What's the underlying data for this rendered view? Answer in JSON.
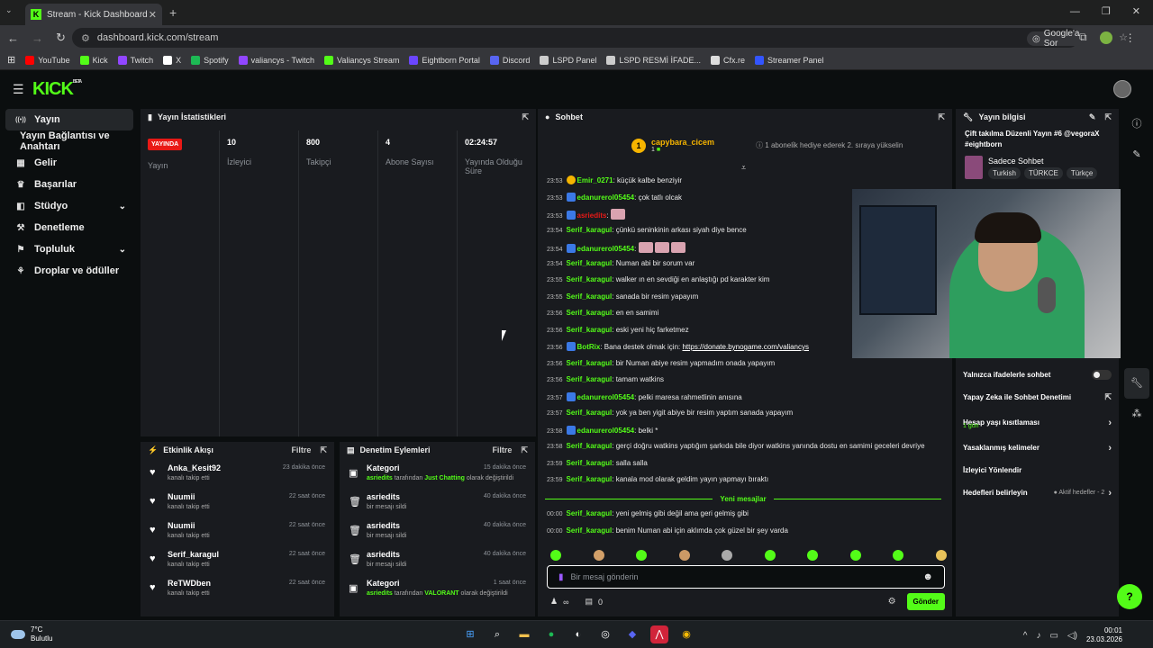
{
  "browser": {
    "tab_title": "Stream - Kick Dashboard",
    "url": "dashboard.kick.com/stream",
    "google_ask": "Google'a Sor",
    "bookmarks": [
      "YouTube",
      "Kick",
      "Twitch",
      "X",
      "Spotify",
      "valiancys - Twitch",
      "Valiancys Stream",
      "Eightborn Portal",
      "Discord",
      "LSPD Panel",
      "LSPD RESMİ İFADE...",
      "Cfx.re",
      "Streamer Panel"
    ],
    "bookmark_colors": [
      "#ff0000",
      "#53fc18",
      "#9146ff",
      "#ffffff",
      "#1db954",
      "#9146ff",
      "#53fc18",
      "#6b46ff",
      "#5865f2",
      "#cccccc",
      "#cccccc",
      "#dddddd",
      "#3355ff"
    ]
  },
  "kick": {
    "logo": "KICK",
    "logo_badge": "BETA"
  },
  "sidebar": {
    "items": [
      {
        "label": "Yayın",
        "icon": "broadcast-icon",
        "active": true,
        "chevron": false
      },
      {
        "label": "Yayın Bağlantısı ve Anahtarı",
        "icon": "",
        "active": false,
        "chevron": false
      },
      {
        "label": "Gelir",
        "icon": "revenue-icon",
        "active": false,
        "chevron": false
      },
      {
        "label": "Başarılar",
        "icon": "trophy-icon",
        "active": false,
        "chevron": false
      },
      {
        "label": "Stüdyo",
        "icon": "studio-icon",
        "active": false,
        "chevron": true
      },
      {
        "label": "Denetleme",
        "icon": "moderation-icon",
        "active": false,
        "chevron": false
      },
      {
        "label": "Topluluk",
        "icon": "community-icon",
        "active": false,
        "chevron": true
      },
      {
        "label": "Droplar ve ödüller",
        "icon": "gift-icon",
        "active": false,
        "chevron": false
      }
    ]
  },
  "stats": {
    "title": "Yayın İstatistikleri",
    "live_badge": "YAYINDA",
    "live_label": "Yayın",
    "columns": [
      {
        "value": "10",
        "label": "İzleyici"
      },
      {
        "value": "800",
        "label": "Takipçi"
      },
      {
        "value": "4",
        "label": "Abone Sayısı"
      },
      {
        "value": "02:24:57",
        "label": "Yayında Olduğu Süre"
      }
    ]
  },
  "activity": {
    "title": "Etkinlik Akışı",
    "filter": "Filtre",
    "items": [
      {
        "name": "Anka_Kesit92",
        "sub": "kanalı takip etti",
        "time": "23 dakika önce"
      },
      {
        "name": "Nuumii",
        "sub": "kanalı takip etti",
        "time": "22 saat önce"
      },
      {
        "name": "Nuumii",
        "sub": "kanalı takip etti",
        "time": "22 saat önce"
      },
      {
        "name": "Serif_karagul",
        "sub": "kanalı takip etti",
        "time": "22 saat önce"
      },
      {
        "name": "ReTWDben",
        "sub": "kanalı takip etti",
        "time": "22 saat önce"
      }
    ]
  },
  "moderation": {
    "title": "Denetim Eylemleri",
    "filter": "Filtre",
    "items": [
      {
        "name": "Kategori",
        "sub_user": "asriedits",
        "sub_mid": " tarafından ",
        "sub_cat": "Just Chatting",
        "sub_end": " olarak değiştirildi",
        "time": "15 dakika önce",
        "icon": "category-icon"
      },
      {
        "name": "asriedits",
        "sub_user": "",
        "sub_mid": "bir mesajı sildi",
        "sub_cat": "",
        "sub_end": "",
        "time": "40 dakika önce",
        "icon": "trash-icon"
      },
      {
        "name": "asriedits",
        "sub_user": "",
        "sub_mid": "bir mesajı sildi",
        "sub_cat": "",
        "sub_end": "",
        "time": "40 dakika önce",
        "icon": "trash-icon"
      },
      {
        "name": "asriedits",
        "sub_user": "",
        "sub_mid": "bir mesajı sildi",
        "sub_cat": "",
        "sub_end": "",
        "time": "40 dakika önce",
        "icon": "trash-icon"
      },
      {
        "name": "Kategori",
        "sub_user": "asriedits",
        "sub_mid": " tarafından ",
        "sub_cat": "VALORANT",
        "sub_end": " olarak değiştirildi",
        "time": "1 saat önce",
        "icon": "category-icon"
      }
    ]
  },
  "chat": {
    "title": "Sohbet",
    "pinned_user": "capybara_cicem",
    "pinned_count": "1",
    "pinned_badge": "1",
    "pinned_text": "1 aboneli̇k hediye ederek 2. sıraya yükselin",
    "messages": [
      {
        "t": "23:53",
        "u": "Emir_0271",
        "c": "#53fc18",
        "m": "küçük kalbe benziyir",
        "b": "sub"
      },
      {
        "t": "23:53",
        "u": "edanurerol05454",
        "c": "#53fc18",
        "m": "çok tatlı olcak",
        "b": "blue"
      },
      {
        "t": "23:53",
        "u": "asriedits",
        "c": "#e91916",
        "m": "[emote]",
        "b": "blue"
      },
      {
        "t": "23:54",
        "u": "Serif_karagul",
        "c": "#53fc18",
        "m": "çünkü seninkinin arkası siyah diye bence",
        "b": ""
      },
      {
        "t": "23:54",
        "u": "edanurerol05454",
        "c": "#53fc18",
        "m": "[emote][emote][emote]",
        "b": "blue"
      },
      {
        "t": "23:54",
        "u": "Serif_karagul",
        "c": "#53fc18",
        "m": "Numan abi bir sorum var",
        "b": ""
      },
      {
        "t": "23:55",
        "u": "Serif_karagul",
        "c": "#53fc18",
        "m": "walker ın en sevdiği en anlaştığı pd karakter kim",
        "b": ""
      },
      {
        "t": "23:55",
        "u": "Serif_karagul",
        "c": "#53fc18",
        "m": "sanada bir resim yapayım",
        "b": ""
      },
      {
        "t": "23:56",
        "u": "Serif_karagul",
        "c": "#53fc18",
        "m": "en en samimi",
        "b": ""
      },
      {
        "t": "23:56",
        "u": "Serif_karagul",
        "c": "#53fc18",
        "m": "eski yeni hiç farketmez",
        "b": ""
      },
      {
        "t": "23:56",
        "u": "BotRix",
        "c": "#53fc18",
        "m": "Bana destek olmak için: ",
        "link": "https://donate.bynogame.com/valiancys",
        "b": "bot"
      },
      {
        "t": "23:56",
        "u": "Serif_karagul",
        "c": "#53fc18",
        "m": "bir Numan abiye resim yapmadım onada yapayım",
        "b": ""
      },
      {
        "t": "23:56",
        "u": "Serif_karagul",
        "c": "#53fc18",
        "m": "tamam watkins",
        "b": ""
      },
      {
        "t": "23:57",
        "u": "edanurerol05454",
        "c": "#53fc18",
        "m": "pelki maresa rahmetlinin anısına",
        "b": "blue"
      },
      {
        "t": "23:57",
        "u": "Serif_karagul",
        "c": "#53fc18",
        "m": "yok ya ben yigit abiye bir resim yaptım sanada yapayım",
        "b": ""
      },
      {
        "t": "23:58",
        "u": "edanurerol05454",
        "c": "#53fc18",
        "m": "belki *",
        "b": "blue"
      },
      {
        "t": "23:58",
        "u": "Serif_karagul",
        "c": "#53fc18",
        "m": "gerçi doğru watkins yaptığım şarkıda bile diyor watkins yanında dostu en samimi geceleri devriye",
        "b": ""
      },
      {
        "t": "23:59",
        "u": "Serif_karagul",
        "c": "#53fc18",
        "m": "salla salla",
        "b": ""
      },
      {
        "t": "23:59",
        "u": "Serif_karagul",
        "c": "#53fc18",
        "m": "kanala mod olarak geldim yayın yapmayı bıraktı",
        "b": ""
      }
    ],
    "new_messages": "Yeni mesajlar",
    "new": [
      {
        "t": "00:00",
        "u": "Serif_karagul",
        "c": "#53fc18",
        "m": "yeni gelmiş gibi değil ama geri gelmiş gibi",
        "b": ""
      },
      {
        "t": "00:00",
        "u": "Serif_karagul",
        "c": "#53fc18",
        "m": "benim Numan abi için aklımda çok güzel bir şey varda",
        "b": ""
      }
    ],
    "placeholder": "Bir mesaj gönderin",
    "viewers": "∞",
    "points": "0",
    "send": "Gönder"
  },
  "stream_info": {
    "title": "Yayın bilgisi",
    "stream_title": "Çift takılma Düzenli Yayın #6 @vegoraX #eightborn",
    "category": "Sadece Sohbet",
    "tags": [
      "Turkish",
      "TÜRKCE",
      "Türkçe"
    ],
    "settings": [
      {
        "label": "Yalnızca ifadelerle sohbet",
        "type": "toggle",
        "sub": "",
        "hint": ""
      },
      {
        "label": "Yapay Zeka ile Sohbet Denetimi",
        "type": "external",
        "sub": "",
        "hint": ""
      },
      {
        "label": "Hesap yaşı kısıtlaması",
        "type": "arrow",
        "sub": "1 gün",
        "hint": ""
      },
      {
        "label": "Yasaklanmış kelimeler",
        "type": "arrow",
        "sub": "",
        "hint": ""
      },
      {
        "label": "İzleyici Yönlendir",
        "type": "none",
        "sub": "",
        "hint": ""
      },
      {
        "label": "Hedefleri belirleyin",
        "type": "arrow",
        "sub": "",
        "hint": "● Aktif hedefler - 2"
      }
    ]
  },
  "taskbar": {
    "temp": "7°C",
    "weather": "Bulutlu",
    "time": "00:01",
    "date": "23.03.2026"
  }
}
